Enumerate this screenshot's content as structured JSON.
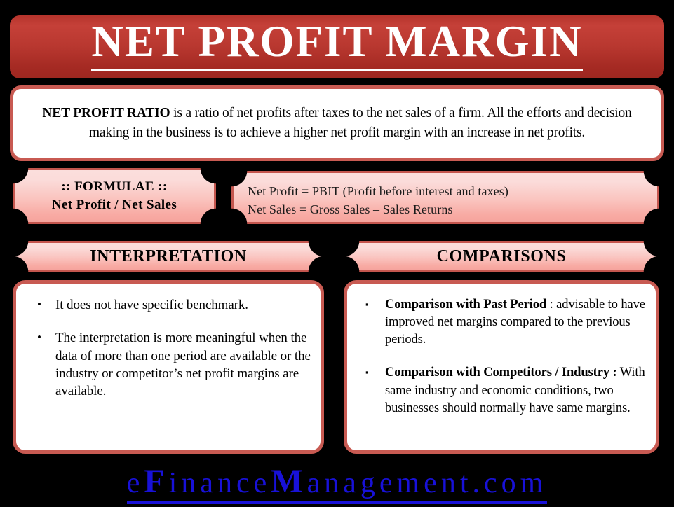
{
  "meta": {
    "background_color": "#000000",
    "accent_red": "#b5342c",
    "border_red": "#c85a52",
    "plaque_pink_top": "#fbdedc",
    "plaque_pink_bottom": "#f6a49d",
    "footer_blue": "#1811d8"
  },
  "title": {
    "text": "NET PROFIT MARGIN"
  },
  "description": {
    "lead": "NET PROFIT RATIO",
    "rest": " is a ratio of net profits after taxes to the net sales of a firm. All the efforts and decision making in the business is to achieve a higher net profit margin with an increase in net profits."
  },
  "formulae": {
    "heading": ":: FORMULAE ::",
    "formula": "Net Profit / Net Sales",
    "definitions": [
      "Net Profit =  PBIT (Profit before interest and taxes)",
      "Net Sales =  Gross Sales – Sales Returns"
    ]
  },
  "sections": {
    "interpretation": {
      "header": "INTERPRETATION",
      "bullet_marker": "•",
      "items": [
        {
          "lead": "",
          "text": "It does not have specific benchmark."
        },
        {
          "lead": "",
          "text": "The interpretation is more meaningful when the data of more than one period are available or the industry or competitor’s net profit margins are available."
        }
      ]
    },
    "comparisons": {
      "header": "COMPARISONS",
      "bullet_marker": "▪",
      "items": [
        {
          "lead": "Comparison with Past Period",
          "text": " : advisable to have improved net margins compared to the previous periods."
        },
        {
          "lead": "Comparison with Competitors / Industry :",
          "text": " With same industry and economic conditions, two businesses should normally have same margins."
        }
      ]
    }
  },
  "footer": {
    "part1": "e",
    "cap1": "F",
    "part2": "inance",
    "cap2": "M",
    "part3": "anagement.com",
    "full": "eFinanceManagement.com"
  }
}
